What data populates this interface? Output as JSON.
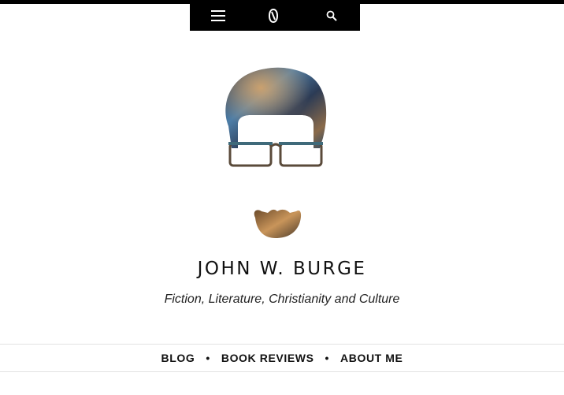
{
  "toolbar": {
    "menu_icon": "hamburger-menu-icon",
    "logo_icon": "site-monogram-icon",
    "search_icon": "search-icon"
  },
  "logo": {
    "icon": "face-silhouette-logo",
    "palette": {
      "nebula_dark": "#2c3b55",
      "nebula_blue": "#4d7ea8",
      "nebula_gold": "#b07a3e",
      "glasses_frame": "#5a4a3a"
    }
  },
  "site": {
    "title": "JOHN W. BURGE",
    "tagline": "Fiction, Literature, Christianity and Culture"
  },
  "nav": {
    "items": [
      {
        "label": "BLOG"
      },
      {
        "label": "BOOK REVIEWS"
      },
      {
        "label": "ABOUT ME"
      }
    ],
    "separator": "•"
  }
}
